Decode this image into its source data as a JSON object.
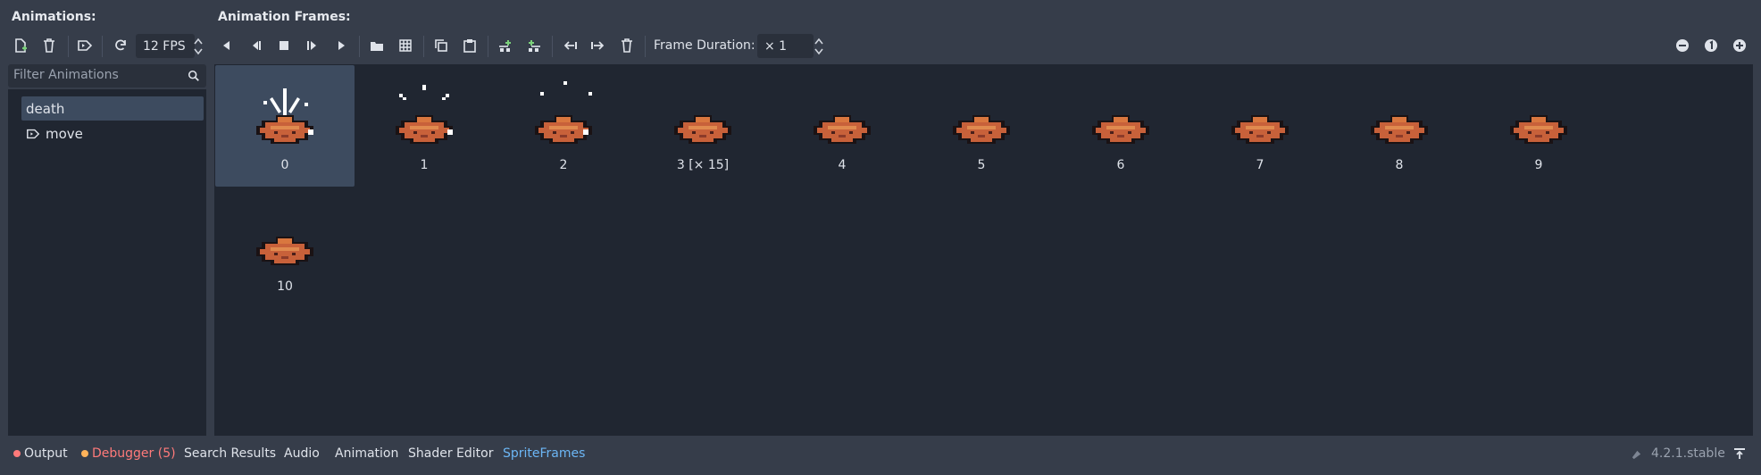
{
  "animations_panel": {
    "title": "Animations:",
    "filter_placeholder": "Filter Animations",
    "fps_value": "12 FPS",
    "items": [
      {
        "label": "death",
        "selected": true
      },
      {
        "label": "move",
        "selected": false
      }
    ]
  },
  "frames_panel": {
    "title": "Animation Frames:",
    "frame_duration_label": "Frame Duration:",
    "frame_duration_value": "× 1",
    "frames": [
      {
        "label": "0",
        "selected": true
      },
      {
        "label": "1"
      },
      {
        "label": "2"
      },
      {
        "label": "3 [× 15]"
      },
      {
        "label": "4"
      },
      {
        "label": "5"
      },
      {
        "label": "6"
      },
      {
        "label": "7"
      },
      {
        "label": "8"
      },
      {
        "label": "9"
      },
      {
        "label": "10"
      }
    ]
  },
  "bottom_bar": {
    "tabs": {
      "output": "Output",
      "debugger": "Debugger (5)",
      "search_results": "Search Results",
      "audio": "Audio",
      "animation": "Animation",
      "shader_editor": "Shader Editor",
      "spriteframes": "SpriteFrames"
    },
    "version": "4.2.1.stable"
  },
  "colors": {
    "background": "#363d4a",
    "panel": "#202631",
    "selection": "#3d4b5f",
    "accent_blue": "#6cb6f5",
    "error_red": "#ff7a7a",
    "debugger_orange": "#ffb35a",
    "sprite_body": "#c8613a"
  }
}
